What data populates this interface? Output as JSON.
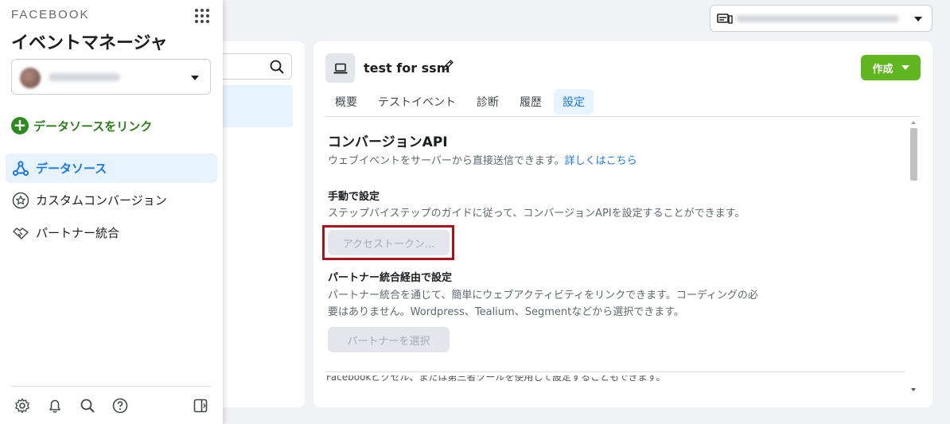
{
  "sidebar": {
    "brand": "FACEBOOK",
    "app_title": "イベントマネージャ",
    "link_source_label": "データソースをリンク",
    "items": [
      {
        "label": "データソース",
        "icon": "data-source-icon"
      },
      {
        "label": "カスタムコンバージョン",
        "icon": "star-icon"
      },
      {
        "label": "パートナー統合",
        "icon": "handshake-icon"
      }
    ],
    "footer_icons": [
      "gear-icon",
      "bell-icon",
      "search-icon",
      "help-icon",
      "collapse-panel-icon"
    ]
  },
  "data_source": {
    "title": "test for ssm",
    "create_label": "作成"
  },
  "tabs": [
    {
      "label": "概要"
    },
    {
      "label": "テストイベント"
    },
    {
      "label": "診断"
    },
    {
      "label": "履歴"
    },
    {
      "label": "設定"
    }
  ],
  "active_tab": "設定",
  "conversion_api": {
    "title": "コンバージョンAPI",
    "description": "ウェブイベントをサーバーから直接送信できます。",
    "learn_more": "詳しくはこちら",
    "manual": {
      "heading": "手動で設定",
      "description": "ステップバイステップのガイドに従って、コンバージョンAPIを設定することができます。",
      "button_label": "アクセストークン..."
    },
    "partner": {
      "heading": "パートナー統合経由で設定",
      "description_line1": "パートナー統合を通じて、簡単にウェブアクティビティをリンクできます。コーディングの必",
      "description_line2": "要はありません。Wordpress、Tealium、Segmentなどから選択できます。",
      "button_label": "パートナーを選択"
    },
    "cut_off_text": "Facebookピクセル、または第三者ツールを使用して設定することもできます。詳しくはこちら"
  },
  "colors": {
    "accent": "#1877f2",
    "create_button": "#5fb61e",
    "highlight_border": "#b0121b",
    "link_green": "#2d7d1b"
  }
}
